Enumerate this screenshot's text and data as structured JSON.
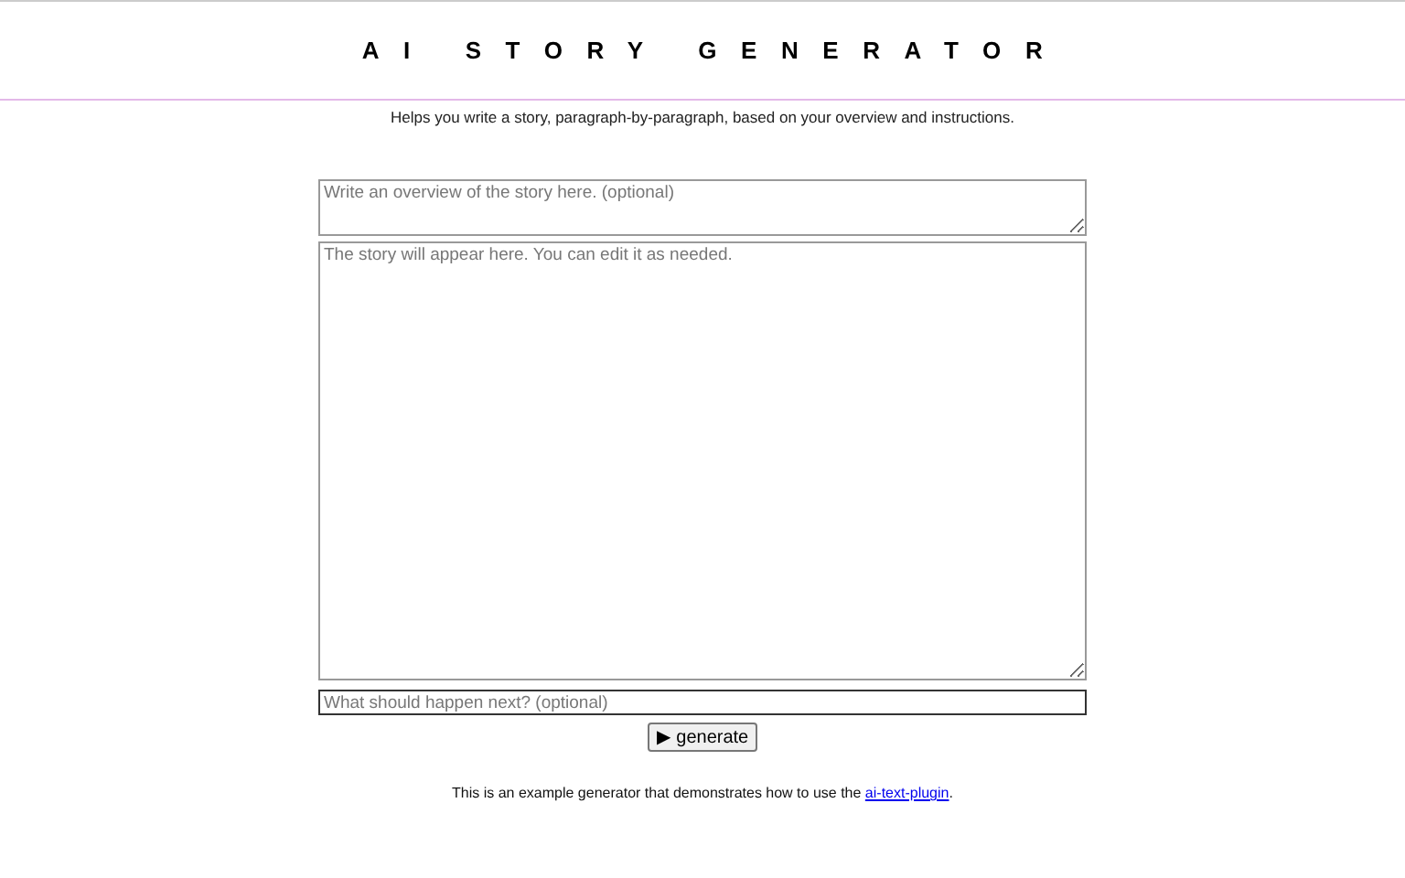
{
  "header": {
    "title": "AI STORY GENERATOR"
  },
  "subtitle": "Helps you write a story, paragraph-by-paragraph, based on your overview and instructions.",
  "overview": {
    "placeholder": "Write an overview of the story here. (optional)"
  },
  "story": {
    "placeholder": "The story will appear here. You can edit it as needed."
  },
  "instruction": {
    "placeholder": "What should happen next? (optional)"
  },
  "generate_button": {
    "icon": "▶",
    "label": "generate"
  },
  "footer": {
    "text": "This is an example generator that demonstrates how to use the ",
    "link": "ai-text-plugin",
    "end": "."
  }
}
